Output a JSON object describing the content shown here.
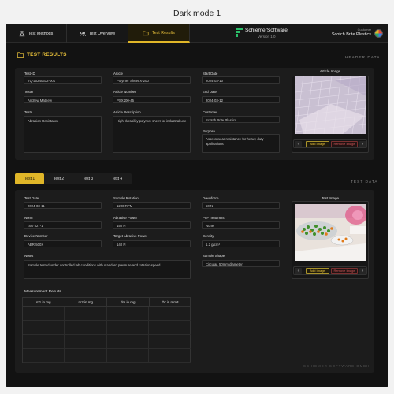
{
  "caption": "Dark mode 1",
  "nav": {
    "tabs": [
      {
        "label": "Test Methods",
        "icon": "flask-icon"
      },
      {
        "label": "Test Overview",
        "icon": "users-icon"
      },
      {
        "label": "Test Results",
        "icon": "folder-icon",
        "active": true
      }
    ],
    "brand_name": "SchiemerSoftware",
    "version": "Version 1.0",
    "customer_label": "Customer",
    "customer_name": "Scotch Brite Plastics"
  },
  "header_section": {
    "title": "TEST RESULTS",
    "side_label": "HEADER DATA",
    "test_id_label": "Test-ID",
    "test_id": "TQ-20240312-001",
    "tester_label": "Tester",
    "tester": "Andrew Mathew",
    "tests_label": "Tests",
    "tests": "Abrasion Resistance",
    "article_label": "Article",
    "article": "Polymer Sheet X-200",
    "article_number_label": "Article Number",
    "article_number": "PSX200-45",
    "article_description_label": "Article Description",
    "article_description": "High-durability polymer sheet for industrial use",
    "start_date_label": "Start Date",
    "start_date": "2024-03-10",
    "end_date_label": "End Date",
    "end_date": "2024-03-12",
    "customer_label": "Customer",
    "customer": "Scotch Brite Plastics",
    "purpose_label": "Purpose",
    "purpose": "Assess wear resistance for heavy-duty applications",
    "image_title": "Article Image",
    "add_image": "Add Image",
    "remove_image": "Remove Image",
    "prev": "‹",
    "next": "›"
  },
  "test_tabs": [
    "Test 1",
    "Test 2",
    "Test 3",
    "Test 4"
  ],
  "test_section": {
    "side_label": "TEST DATA",
    "test_date_label": "Test Date",
    "test_date": "2024-03-11",
    "norm_label": "Norm",
    "norm": "ISO 527-1",
    "device_number_label": "Device Number",
    "device_number": "ABR-500X",
    "notes_label": "Notes",
    "notes": "Sample tested under controlled lab conditions with standard pressure and rotation speed.",
    "sample_rotation_label": "Sample Rotation",
    "sample_rotation": "1200 RPM",
    "abrasive_power_label": "Abrasive Power",
    "abrasive_power": "150 N",
    "target_abrasive_power_label": "Target Abrasive Power",
    "target_abrasive_power": "140 N",
    "downforce_label": "Downforce",
    "downforce": "50 N",
    "pre_treatment_label": "Pre-Treatment",
    "pre_treatment": "None",
    "density_label": "Density",
    "density": "1.2 g/cm³",
    "sample_shape_label": "Sample Shape",
    "sample_shape": "Circular, 50mm diameter",
    "image_title": "Test Image",
    "add_image": "Add Image",
    "remove_image": "Remove Image",
    "prev": "‹",
    "next": "›"
  },
  "measurement": {
    "title": "Measurement Results",
    "columns": [
      "m1 in mg",
      "m2 in mg",
      "dm in mg",
      "dV in mm3"
    ]
  },
  "footer": "SCHIEMER SOFTWARE GMBH",
  "colors": {
    "accent": "#e0b628",
    "danger": "#d65a5a",
    "bg": "#121212",
    "panel": "#1c1c1c"
  }
}
